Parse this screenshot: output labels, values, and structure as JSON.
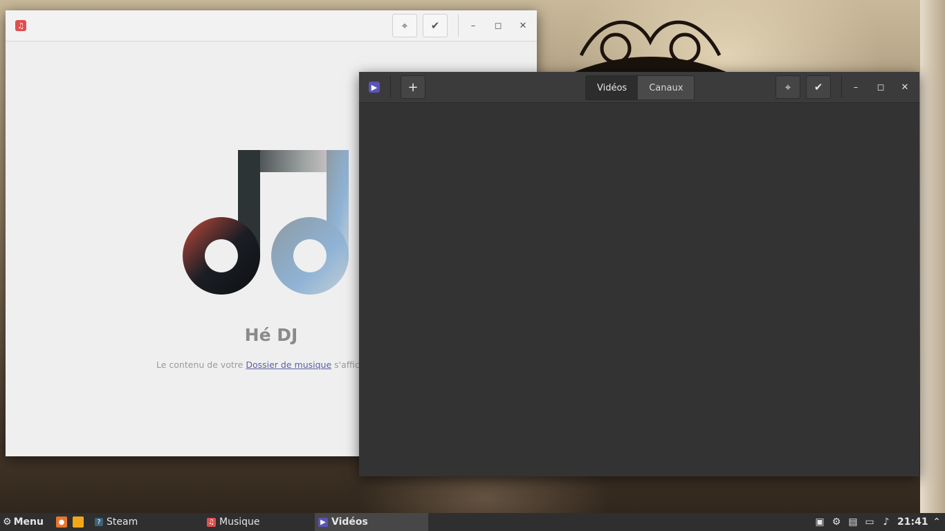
{
  "music_window": {
    "heading": "Hé DJ",
    "subtitle_prefix": "Le contenu de votre ",
    "subtitle_link": "Dossier de musique",
    "subtitle_suffix": " s'affich"
  },
  "videos_window": {
    "add_label": "+",
    "tab_videos": "Vidéos",
    "tab_channels": "Canaux"
  },
  "taskbar": {
    "menu_label": "Menu",
    "items": [
      {
        "label": "Steam"
      },
      {
        "label": "Musique"
      },
      {
        "label": "Vidéos"
      }
    ],
    "clock": "21:41"
  },
  "colors": {
    "music_accent": "#e04f4f",
    "videos_accent": "#5a54b8",
    "link": "#5b5ea6"
  }
}
